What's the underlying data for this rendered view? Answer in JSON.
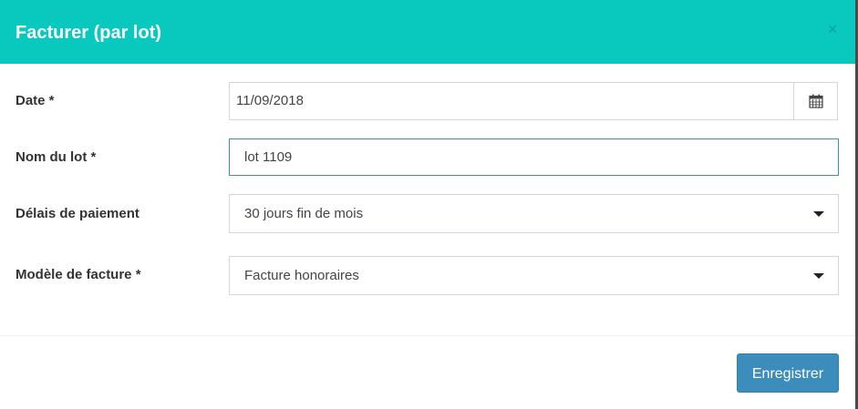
{
  "modal": {
    "title": "Facturer (par lot)",
    "close_glyph": "×",
    "close_icon": "close-icon"
  },
  "form": {
    "date": {
      "label": "Date *",
      "value": "11/09/2018",
      "icon": "calendar-icon"
    },
    "batch_name": {
      "label": "Nom du lot *",
      "value": "lot 1109"
    },
    "payment_terms": {
      "label": "Délais de paiement",
      "selected": "30 jours fin de mois"
    },
    "invoice_template": {
      "label": "Modèle de facture *",
      "selected": "Facture honoraires"
    }
  },
  "footer": {
    "save_label": "Enregistrer"
  },
  "colors": {
    "header": "#09c9bf",
    "primary_button": "#3c8dbc",
    "focus_border": "#3c8dbc"
  }
}
